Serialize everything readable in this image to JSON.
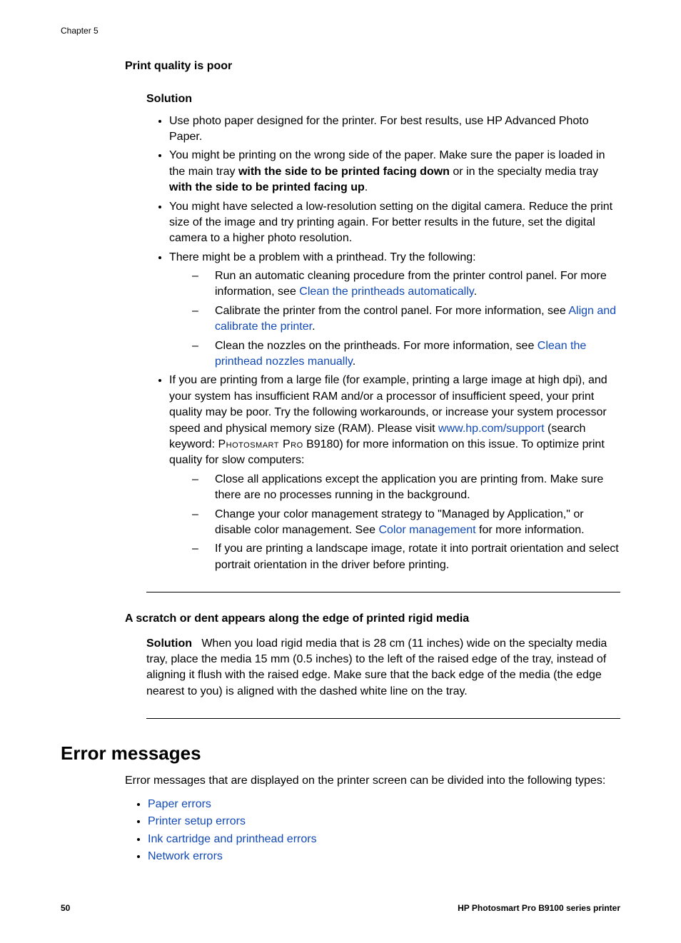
{
  "header": {
    "chapter": "Chapter 5"
  },
  "problem1": {
    "title": "Print quality is poor",
    "solution_label": "Solution",
    "b1": "Use photo paper designed for the printer. For best results, use HP Advanced Photo Paper.",
    "b2_pre": "You might be printing on the wrong side of the paper. Make sure the paper is loaded in the main tray ",
    "b2_bold1": "with the side to be printed facing down",
    "b2_mid": " or in the specialty media tray ",
    "b2_bold2": "with the side to be printed facing up",
    "b2_post": ".",
    "b3": "You might have selected a low-resolution setting on the digital camera. Reduce the print size of the image and try printing again. For better results in the future, set the digital camera to a higher photo resolution.",
    "b4_pre": "There might be a problem with a printhead. Try the following:",
    "b4_d1_pre": "Run an automatic cleaning procedure from the printer control panel. For more information, see ",
    "b4_d1_link": "Clean the printheads automatically",
    "b4_d1_post": ".",
    "b4_d2_pre": "Calibrate the printer from the control panel. For more information, see ",
    "b4_d2_link": "Align and calibrate the printer",
    "b4_d2_post": ".",
    "b4_d3_pre": "Clean the nozzles on the printheads. For more information, see ",
    "b4_d3_link": "Clean the printhead nozzles manually",
    "b4_d3_post": ".",
    "b5_pre": "If you are printing from a large file (for example, printing a large image at high dpi), and your system has insufficient RAM and/or a processor of insufficient speed, your print quality may be poor. Try the following workarounds, or increase your system processor speed and physical memory size (RAM). Please visit ",
    "b5_link": "www.hp.com/support",
    "b5_mid": " (search keyword: ",
    "b5_sc": "Photosmart Pro",
    "b5_post": " B9180) for more information on this issue. To optimize print quality for slow computers:",
    "b5_d1": "Close all applications except the application you are printing from. Make sure there are no processes running in the background.",
    "b5_d2_pre": "Change your color management strategy to \"Managed by Application,\" or disable color management. See ",
    "b5_d2_link": "Color management",
    "b5_d2_post": " for more information.",
    "b5_d3": "If you are printing a landscape image, rotate it into portrait orientation and select portrait orientation in the driver before printing."
  },
  "problem2": {
    "title": "A scratch or dent appears along the edge of printed rigid media",
    "solution_label": "Solution",
    "body": "When you load rigid media that is 28 cm (11 inches) wide on the specialty media tray, place the media 15 mm (0.5 inches) to the left of the raised edge of the tray, instead of aligning it flush with the raised edge. Make sure that the back edge of the media (the edge nearest to you) is aligned with the dashed white line on the tray."
  },
  "section": {
    "heading": "Error messages",
    "intro": "Error messages that are displayed on the printer screen can be divided into the following types:",
    "links": {
      "l1": "Paper errors",
      "l2": "Printer setup errors",
      "l3": "Ink cartridge and printhead errors",
      "l4": "Network errors"
    }
  },
  "footer": {
    "page": "50",
    "title": "HP Photosmart Pro B9100 series printer"
  }
}
